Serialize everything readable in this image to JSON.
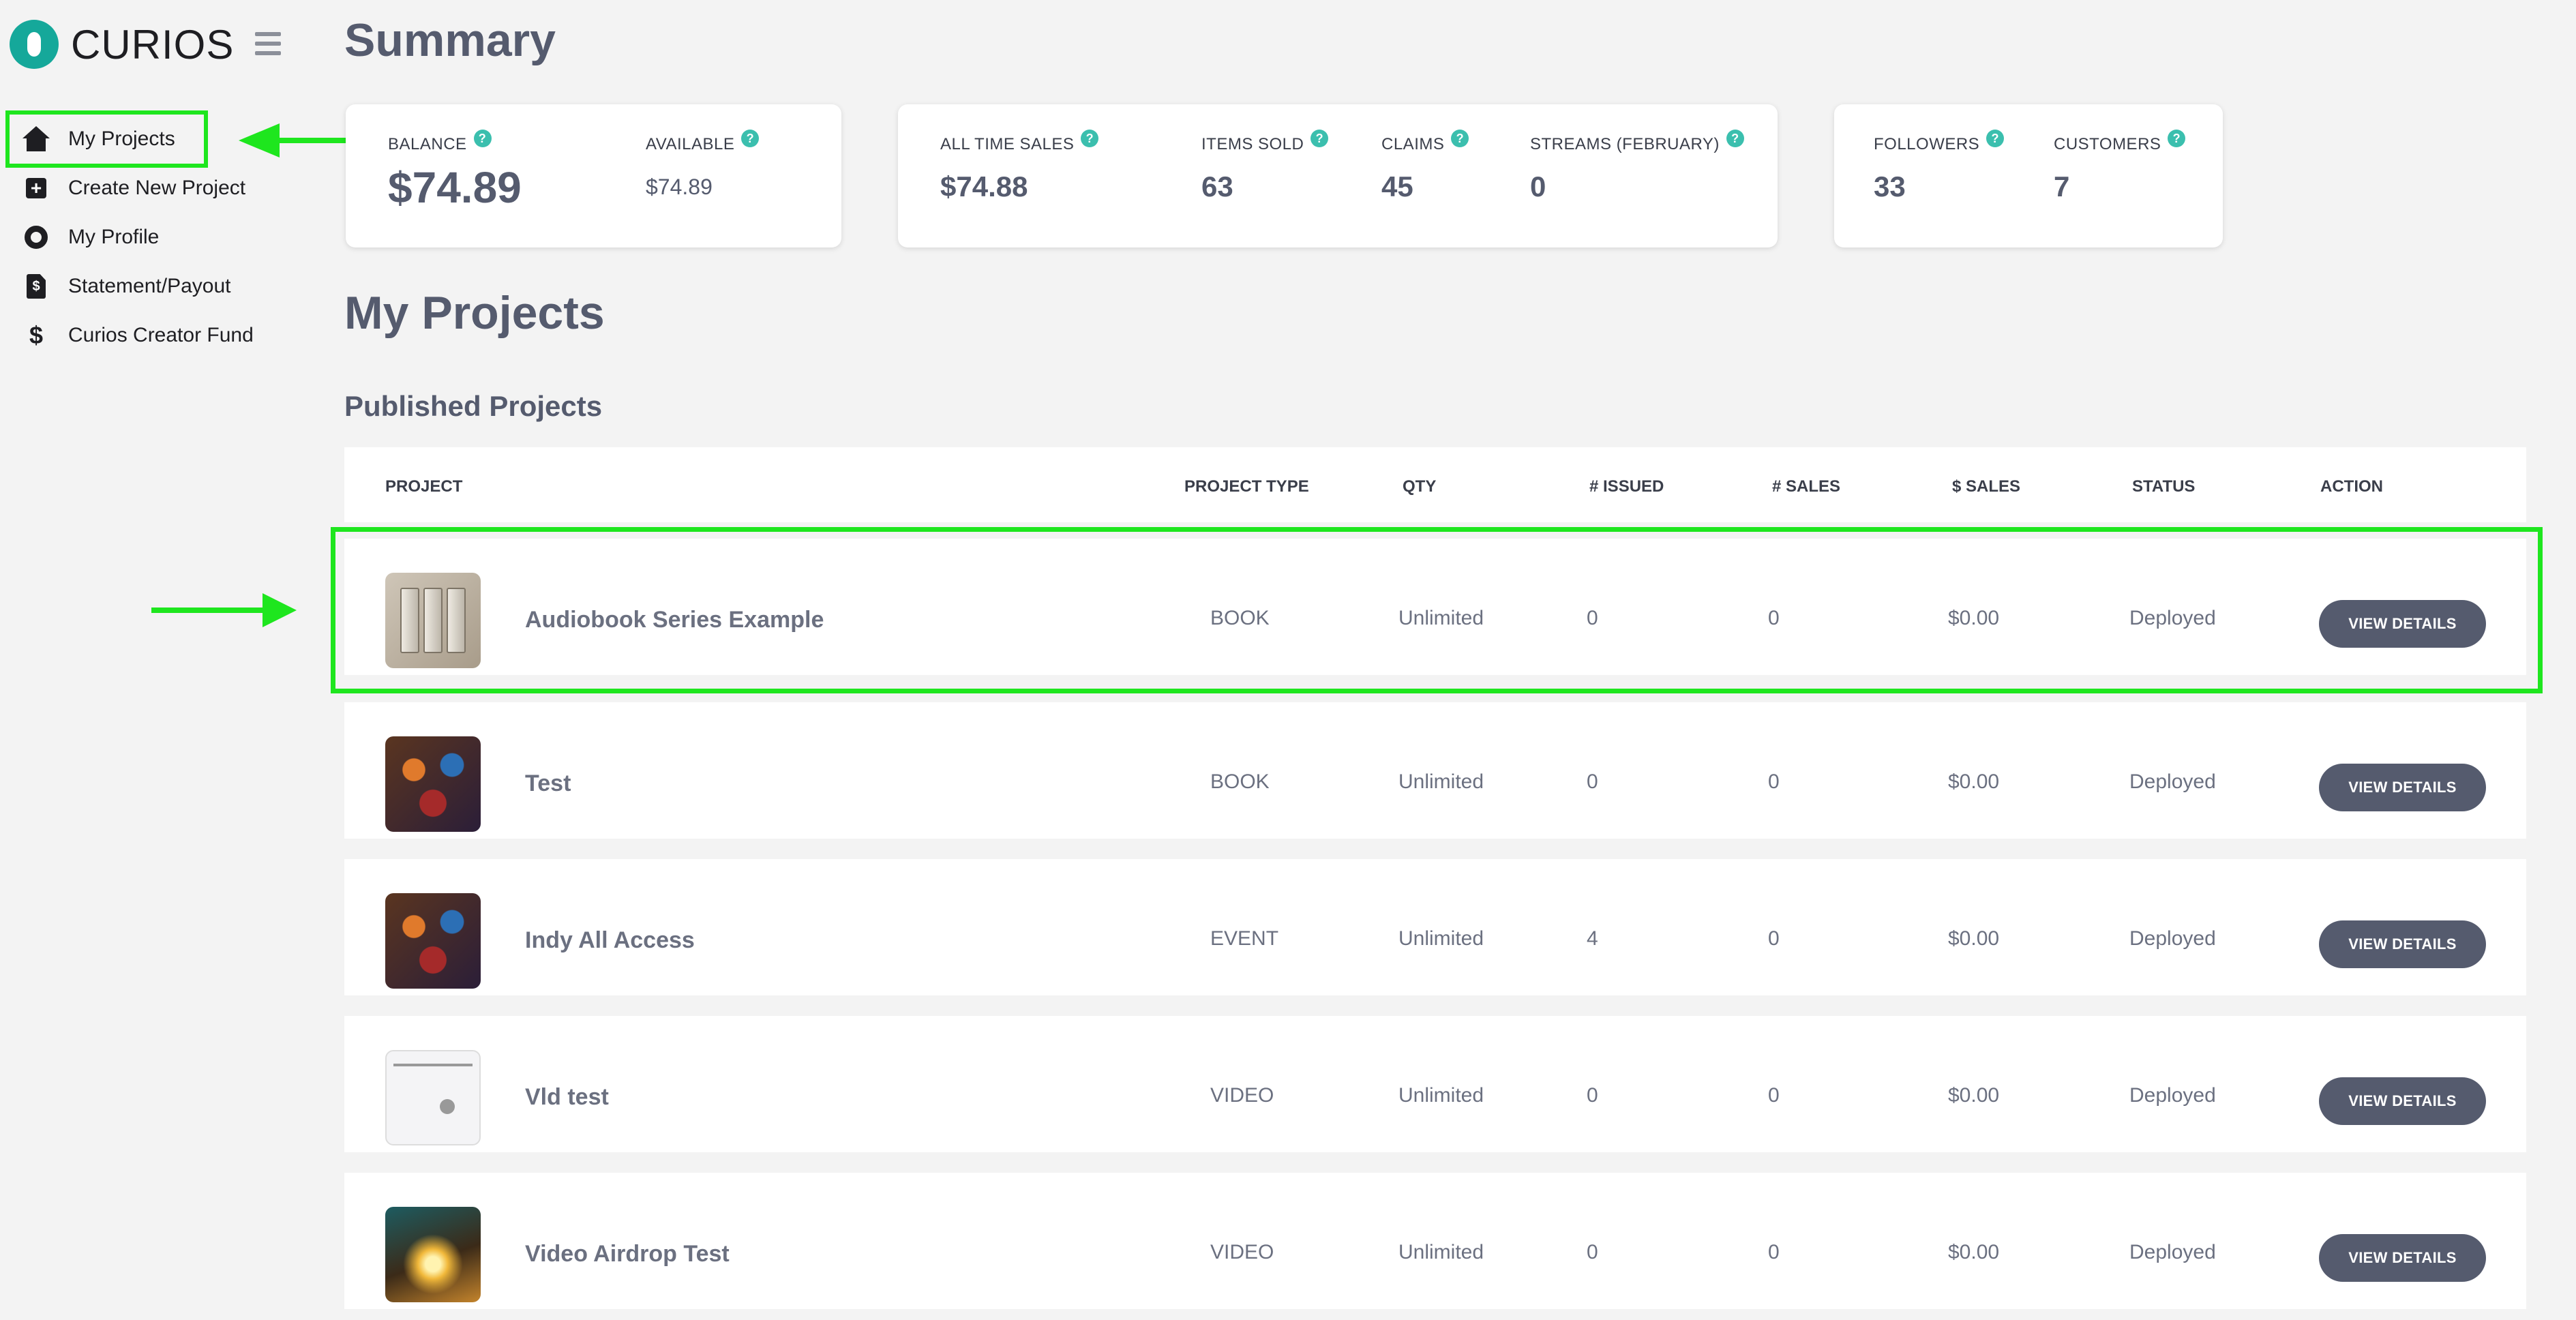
{
  "app": {
    "brand": "CURIOS"
  },
  "sidebar": {
    "items": [
      {
        "label": "My Projects",
        "icon": "home-icon",
        "active": true
      },
      {
        "label": "Create New Project",
        "icon": "plus-square-icon"
      },
      {
        "label": "My Profile",
        "icon": "gear-icon"
      },
      {
        "label": "Statement/Payout",
        "icon": "invoice-icon"
      },
      {
        "label": "Curios Creator Fund",
        "icon": "dollar-icon"
      }
    ]
  },
  "summary": {
    "title": "Summary",
    "balance": {
      "label": "BALANCE",
      "value": "$74.89"
    },
    "available": {
      "label": "AVAILABLE",
      "value": "$74.89"
    },
    "all_time_sales": {
      "label": "ALL TIME SALES",
      "value": "$74.88"
    },
    "items_sold": {
      "label": "ITEMS SOLD",
      "value": "63"
    },
    "claims": {
      "label": "CLAIMS",
      "value": "45"
    },
    "streams": {
      "label": "STREAMS (FEBRUARY)",
      "value": "0"
    },
    "followers": {
      "label": "FOLLOWERS",
      "value": "33"
    },
    "customers": {
      "label": "CUSTOMERS",
      "value": "7"
    },
    "help_glyph": "?"
  },
  "projects": {
    "title": "My Projects",
    "subtitle": "Published Projects",
    "columns": [
      "PROJECT",
      "PROJECT TYPE",
      "QTY",
      "# ISSUED",
      "# SALES",
      "$ SALES",
      "STATUS",
      "ACTION"
    ],
    "rows": [
      {
        "name": "Audiobook Series Example",
        "type": "BOOK",
        "qty": "Unlimited",
        "issued": "0",
        "sales": "0",
        "dollar_sales": "$0.00",
        "status": "Deployed",
        "action": "VIEW DETAILS"
      },
      {
        "name": "Test",
        "type": "BOOK",
        "qty": "Unlimited",
        "issued": "0",
        "sales": "0",
        "dollar_sales": "$0.00",
        "status": "Deployed",
        "action": "VIEW DETAILS"
      },
      {
        "name": "Indy All Access",
        "type": "EVENT",
        "qty": "Unlimited",
        "issued": "4",
        "sales": "0",
        "dollar_sales": "$0.00",
        "status": "Deployed",
        "action": "VIEW DETAILS"
      },
      {
        "name": "Vld test",
        "type": "VIDEO",
        "qty": "Unlimited",
        "issued": "0",
        "sales": "0",
        "dollar_sales": "$0.00",
        "status": "Deployed",
        "action": "VIEW DETAILS"
      },
      {
        "name": "Video Airdrop Test",
        "type": "VIDEO",
        "qty": "Unlimited",
        "issued": "0",
        "sales": "0",
        "dollar_sales": "$0.00",
        "status": "Deployed",
        "action": "VIEW DETAILS"
      }
    ]
  },
  "colors": {
    "accent": "#15a89a",
    "highlight": "#1ee61e",
    "button": "#555b6e",
    "help": "#3bbfae"
  }
}
